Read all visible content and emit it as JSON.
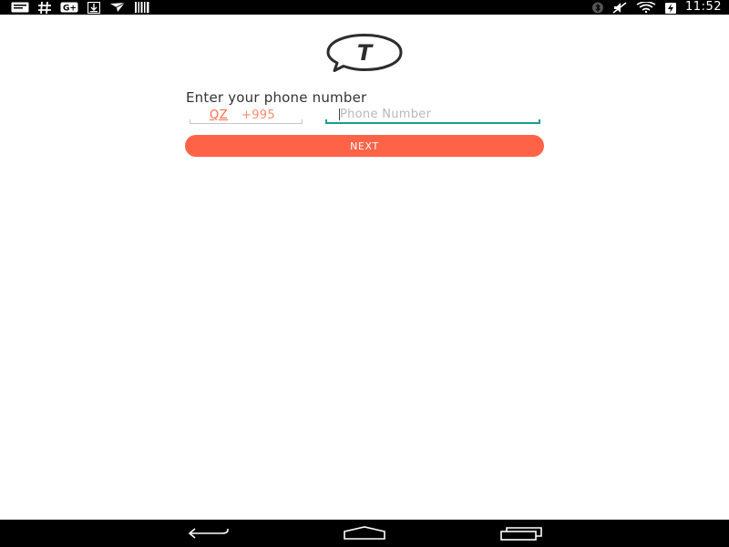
{
  "status_bar": {
    "time": "11:52",
    "left_icons": [
      "message-icon",
      "hash-icon",
      "google-plus-icon",
      "download-icon",
      "airplane-icon",
      "barcode-icon"
    ],
    "right_icons": [
      "bluetooth-icon",
      "muted-icon",
      "wifi-icon",
      "battery-charging-icon"
    ]
  },
  "app": {
    "logo_letter": "T"
  },
  "form": {
    "heading": "Enter your phone number",
    "country_code": "QZ",
    "country_prefix": "+995",
    "phone_placeholder": "Phone Number",
    "phone_value": "",
    "next_label": "NEXT"
  },
  "colors": {
    "accent": "#ff6347",
    "input_focus": "#1a9c91",
    "country_text": "#ff6a4c"
  },
  "nav_bar": {
    "buttons": [
      "back-icon",
      "home-icon",
      "recent-apps-icon"
    ]
  }
}
